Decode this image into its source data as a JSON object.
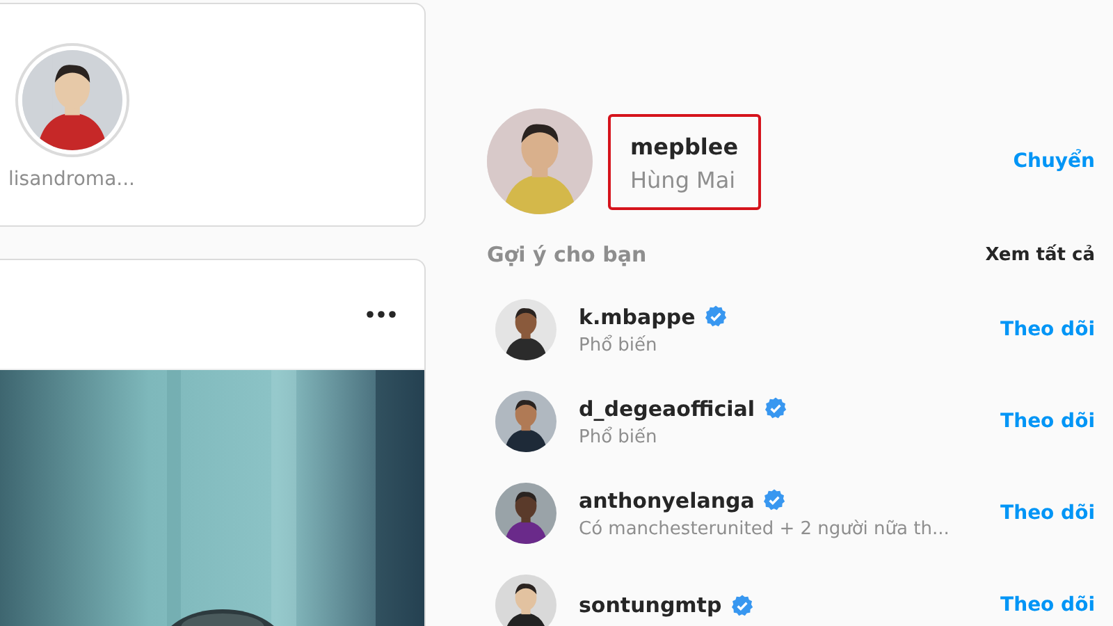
{
  "stories": [
    {
      "username": "lisandroma..."
    }
  ],
  "profile": {
    "username": "mepblee",
    "full_name": "Hùng Mai",
    "highlighted": true,
    "switch_label": "Chuyển"
  },
  "suggestions": {
    "title": "Gợi ý cho bạn",
    "see_all": "Xem tất cả",
    "items": [
      {
        "username": "k.mbappe",
        "verified": true,
        "subtitle": "Phổ biến",
        "follow": "Theo dõi"
      },
      {
        "username": "d_degeaofficial",
        "verified": true,
        "subtitle": "Phổ biến",
        "follow": "Theo dõi"
      },
      {
        "username": "anthonyelanga",
        "verified": true,
        "subtitle": "Có manchesterunited + 2 người nữa th...",
        "follow": "Theo dõi"
      },
      {
        "username": "sontungmtp",
        "verified": true,
        "follow": "Theo dõi"
      }
    ]
  }
}
